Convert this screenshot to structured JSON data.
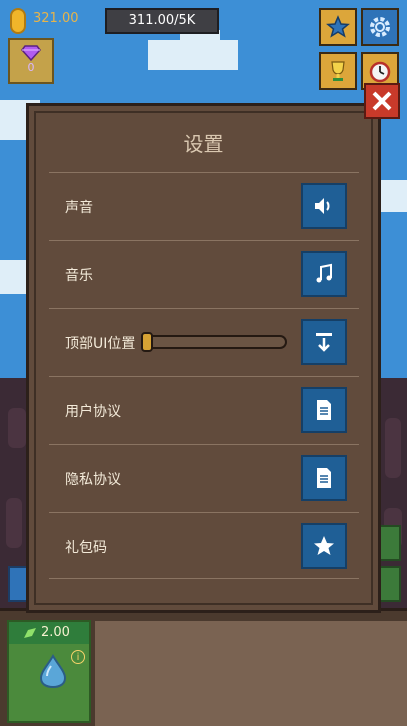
{
  "hud": {
    "coins": "321.00",
    "rate": "311.00/5K",
    "gems": "0"
  },
  "settings": {
    "title": "设置",
    "rows": [
      {
        "label": "声音",
        "icon": "speaker-icon"
      },
      {
        "label": "音乐",
        "icon": "music-note-icon"
      },
      {
        "label": "顶部UI位置",
        "icon": "move-down-icon",
        "slider_value": 0
      },
      {
        "label": "用户协议",
        "icon": "document-icon"
      },
      {
        "label": "隐私协议",
        "icon": "document-icon"
      },
      {
        "label": "礼包码",
        "icon": "star-icon"
      }
    ]
  },
  "upgrade_card": {
    "value": "2.00",
    "icon": "water-drop-icon"
  },
  "colors": {
    "sky": "#3d8fd6",
    "dialog": "#614b3c",
    "button_blue": "#1f5f96",
    "gold": "#dca63a",
    "close_red": "#c83a2a"
  }
}
